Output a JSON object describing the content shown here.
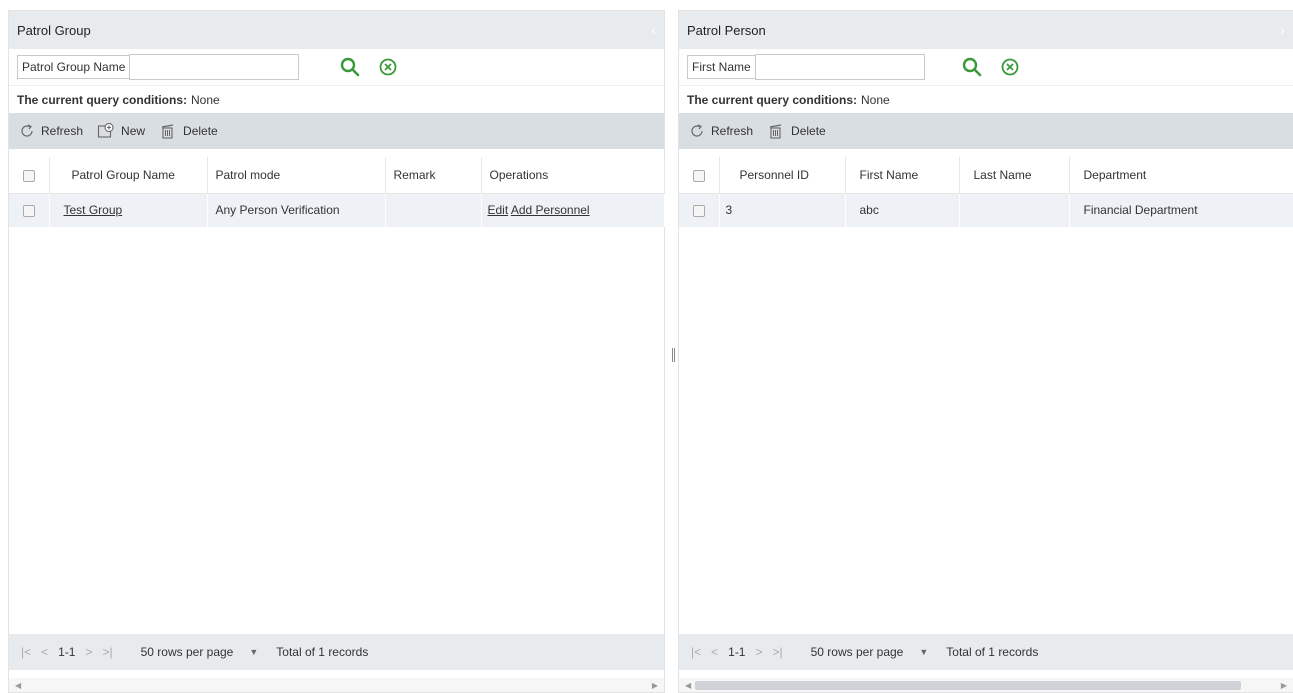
{
  "left": {
    "title": "Patrol Group",
    "search_label": "Patrol Group Name",
    "search_value": "",
    "query_label": "The current query conditions:",
    "query_value": "None",
    "toolbar": {
      "refresh": "Refresh",
      "new": "New",
      "delete": "Delete"
    },
    "columns": [
      "Patrol Group Name",
      "Patrol mode",
      "Remark",
      "Operations"
    ],
    "rows": [
      {
        "name": "Test Group",
        "mode": "Any Person Verification",
        "remark": "",
        "op_edit": "Edit",
        "op_add": "Add Personnel"
      }
    ],
    "pager": {
      "first": "|<",
      "prev": "<",
      "range": "1-1",
      "next": ">",
      "last": ">|",
      "rows_per_page": "50 rows per page",
      "total": "Total of 1 records"
    }
  },
  "right": {
    "title": "Patrol Person",
    "search_label": "First Name",
    "search_value": "",
    "query_label": "The current query conditions:",
    "query_value": "None",
    "toolbar": {
      "refresh": "Refresh",
      "delete": "Delete"
    },
    "columns": [
      "Personnel ID",
      "First Name",
      "Last Name",
      "Department"
    ],
    "rows": [
      {
        "id": "3",
        "first": "abc",
        "last": "",
        "dept": "Financial Department"
      }
    ],
    "pager": {
      "first": "|<",
      "prev": "<",
      "range": "1-1",
      "next": ">",
      "last": ">|",
      "rows_per_page": "50 rows per page",
      "total": "Total of 1 records"
    }
  },
  "colors": {
    "search_icon": "#3a9a3a",
    "header_bg": "#e8ebee",
    "toolbar_bg": "#d9dee3",
    "row_bg": "#eef1f5"
  },
  "icons": [
    "search-icon",
    "clear-icon",
    "refresh-icon",
    "new-icon",
    "delete-icon"
  ]
}
